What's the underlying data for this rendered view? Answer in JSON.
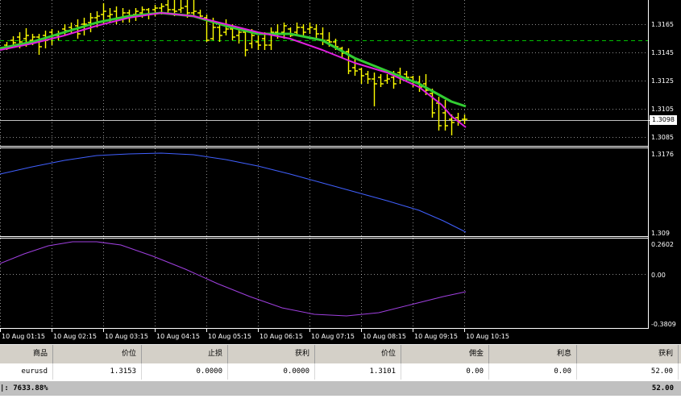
{
  "chart": {
    "price_axis_main": [
      "1.3165",
      "1.3145",
      "1.3125",
      "1.3105",
      "1.3085"
    ],
    "current_price": "1.3098",
    "indicator1_axis": [
      "1.3176",
      "1.309"
    ],
    "indicator2_axis": [
      "0.2602",
      "0.00",
      "-0.3809"
    ],
    "time_labels": [
      "10 Aug 01:15",
      "10 Aug 02:15",
      "10 Aug 03:15",
      "10 Aug 04:15",
      "10 Aug 05:15",
      "10 Aug 06:15",
      "10 Aug 07:15",
      "10 Aug 08:15",
      "10 Aug 09:15",
      "10 Aug 10:15"
    ],
    "colors": {
      "bars": "#ffff00",
      "ma_green": "#32cd32",
      "ma_magenta": "#e020e0",
      "indicator1": "#4060ff",
      "indicator2": "#a040e0",
      "grid": "#ffffff",
      "level_line": "#00c000"
    }
  },
  "terminal": {
    "headers": [
      "商品",
      "价位",
      "止损",
      "获利",
      "价位",
      "佣金",
      "利息",
      "获利"
    ],
    "row": [
      "eurusd",
      "1.3153",
      "0.0000",
      "0.0000",
      "1.3101",
      "0.00",
      "0.00",
      "52.00"
    ],
    "summary_label": "|: 7633.88%",
    "summary_profit": "52.00"
  }
}
